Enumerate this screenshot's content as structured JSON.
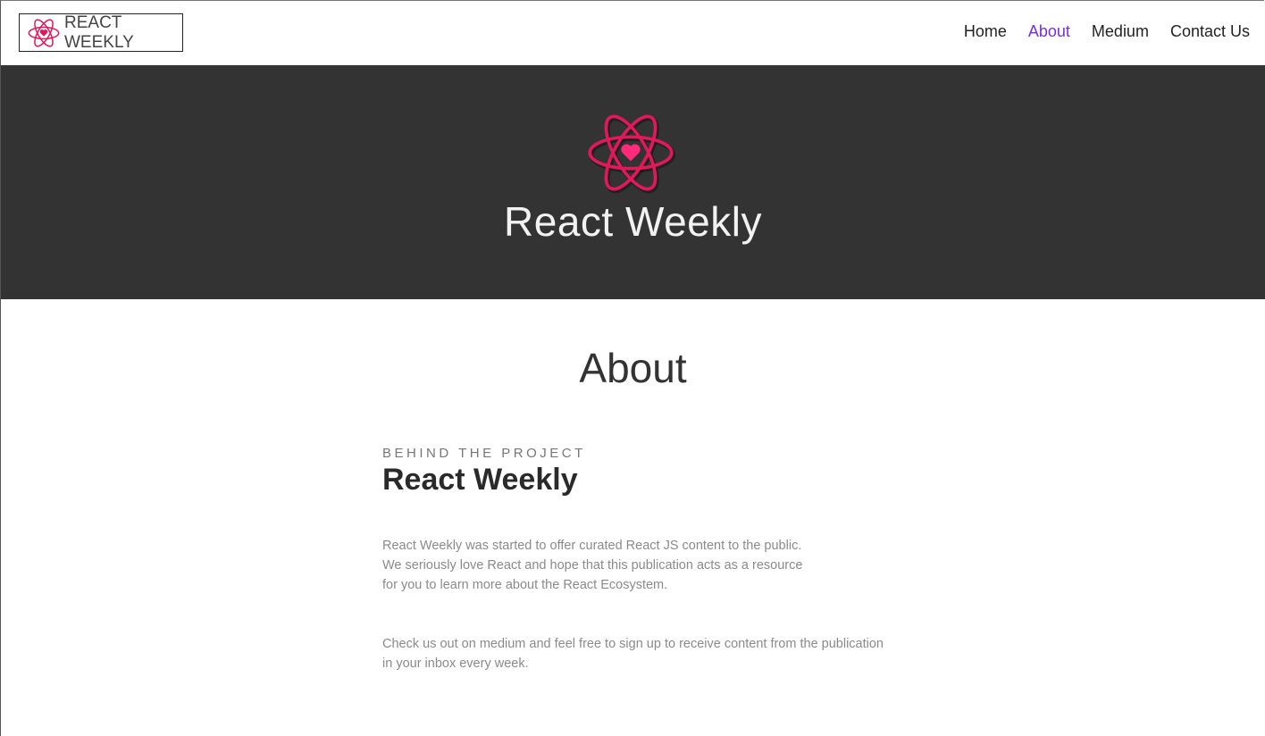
{
  "navbar": {
    "brand_text": "REACT WEEKLY",
    "links": [
      {
        "label": "Home",
        "active": false
      },
      {
        "label": "About",
        "active": true
      },
      {
        "label": "Medium",
        "active": false
      },
      {
        "label": "Contact Us",
        "active": false
      }
    ]
  },
  "hero": {
    "title": "React Weekly",
    "logo_icon": "react-atom-heart-icon"
  },
  "main": {
    "heading": "About",
    "eyebrow": "BEHIND THE PROJECT",
    "title": "React Weekly",
    "paragraphs": [
      "React Weekly was started to offer curated React JS content to the public.\nWe seriously love React and hope that this publication acts as a resource\nfor you to learn more about the React Ecosystem.",
      "Check us out on medium and feel free to sign up to receive content from the publication\nin your inbox every week."
    ]
  },
  "colors": {
    "accent": "#7a2de0",
    "logo_pink": "#e0195a",
    "hero_bg": "#333333"
  }
}
